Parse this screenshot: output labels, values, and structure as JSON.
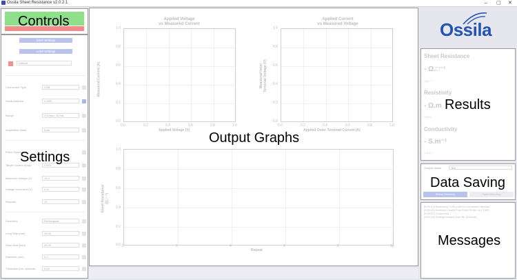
{
  "window": {
    "title": "Ossila Sheet Resistance v2.0.2.1",
    "minimize": "–",
    "maximize": "▢",
    "close": "✕"
  },
  "controls": {
    "heading": "Controls",
    "run_label": "",
    "abort_label": "Abort"
  },
  "settings": {
    "heading": "Settings",
    "save_label": "Save Settings",
    "load_label": "Load Settings",
    "device": "Default",
    "rows": [
      {
        "label": "Connection Type",
        "value": "USB"
      },
      {
        "label": "Serial Address",
        "value": "COM3"
      },
      {
        "label": "Range",
        "value": "± 10mA / 10 mA"
      },
      {
        "label": "Acquisition Mode",
        "value": "Auto"
      },
      {
        "label": "Probe Spacing",
        "value": ""
      },
      {
        "label": "Target Current (Amp)",
        "value": "0.001"
      },
      {
        "label": "Maximum Voltage (V)",
        "value": "10.0"
      },
      {
        "label": "Voltage Increment (V)",
        "value": "0.01"
      },
      {
        "label": "Repeats",
        "value": "10"
      },
      {
        "label": "Geometry",
        "value": "Rectangular"
      },
      {
        "label": "Long Side (mm)",
        "value": "25.00"
      },
      {
        "label": "Short Side (mm)",
        "value": "25.00"
      },
      {
        "label": "Diameter (mm)",
        "value": "0.0"
      },
      {
        "label": "Thickness (nm, optional)",
        "value": "0.00"
      }
    ]
  },
  "graphs": {
    "heading": "Output Graphs",
    "chart1": {
      "title": "Applied Voltage\nvs Measured Current",
      "xlabel": "Applied Voltage (V)",
      "ylabel": "Measured Current (A)",
      "xticks": [
        "0.0",
        "0.2",
        "0.4",
        "0.6",
        "0.8",
        "1.0"
      ],
      "yticks": [
        "1.0",
        "0.8",
        "0.6",
        "0.4",
        "0.2",
        "0.0"
      ]
    },
    "chart2": {
      "title": "Applied Current\nvs Measured Voltage",
      "xlabel": "Applied Outer Terminal Current (A)",
      "ylabel": "Measured Inner\nTerminal Voltage (V)",
      "xticks": [
        "0.0",
        "0.2",
        "0.4",
        "0.6",
        "0.8",
        "1.0"
      ],
      "yticks": [
        "1.0",
        "0.8",
        "0.6",
        "0.4",
        "0.2",
        "0.0"
      ]
    },
    "chart3": {
      "title": "Sheet Resistance Measurements",
      "xlabel": "Repeat",
      "ylabel": "Sheet Resistance\n(Ω.□⁻¹)",
      "xticks": [
        "0",
        "2",
        "4",
        "6",
        "8",
        "10"
      ],
      "yticks": [
        "1.0",
        "0.8",
        "0.6",
        "0.4",
        "0.2",
        "0.0"
      ]
    }
  },
  "logo": {
    "text": "Ossila",
    "color": "#2453b5"
  },
  "results": {
    "heading": "Results",
    "sheet_label": "Sheet Resistance",
    "sheet_value": "- Ω.□⁻¹",
    "sheet_sub": "± Ω.□⁻¹",
    "resistivity_label": "Resistivity",
    "resistivity_value": "- Ω.m",
    "resistivity_sub": "± Ω.m",
    "conductivity_label": "Conductivity",
    "conductivity_value": "- S.m⁻¹",
    "conductivity_sub": "± S.m⁻¹"
  },
  "saving": {
    "heading": "Data Saving",
    "sample_label": "Sample Name",
    "sample_value": "Test",
    "select_label": "Select Directory",
    "open_label": "Open Directory"
  },
  "messages": {
    "heading": "Messages",
    "lines": [
      "[0:00:01] Searching COM ports for connected devices...",
      "[0:00:02] Detected Ossila Four Point Probe on COM3",
      "[0:00:02] Connected",
      "[0:00:03] Settings loaded from file (Default)"
    ]
  }
}
